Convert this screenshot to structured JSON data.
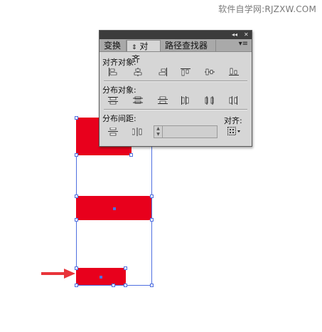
{
  "watermark": "软件自学网:RJZXW.COM",
  "panel": {
    "titlebar": {
      "collapse_icon": "◂◂",
      "close_icon": "✕"
    },
    "tabs": [
      {
        "label": "变换"
      },
      {
        "label": "对齐",
        "prefix": "⇕",
        "active": true
      },
      {
        "label": "路径查找器"
      }
    ],
    "menu_icon": "▾≡",
    "sections": {
      "align_objects": {
        "label": "对齐对象:",
        "buttons": [
          "horizontal-align-left",
          "horizontal-align-center",
          "horizontal-align-right",
          "vertical-align-top",
          "vertical-align-center",
          "vertical-align-bottom"
        ]
      },
      "distribute_objects": {
        "label": "分布对象:",
        "buttons": [
          "vertical-distribute-top",
          "vertical-distribute-center",
          "vertical-distribute-bottom",
          "horizontal-distribute-left",
          "horizontal-distribute-center",
          "horizontal-distribute-right"
        ]
      },
      "distribute_spacing": {
        "label": "分布间距:",
        "buttons": [
          "vertical-distribute-space",
          "horizontal-distribute-space"
        ],
        "spacing_value": ""
      },
      "align_to": {
        "label": "对齐:"
      }
    }
  },
  "colors": {
    "shape_fill": "#e8001c",
    "selection": "#4f6fe0",
    "arrow": "#e8343a"
  }
}
